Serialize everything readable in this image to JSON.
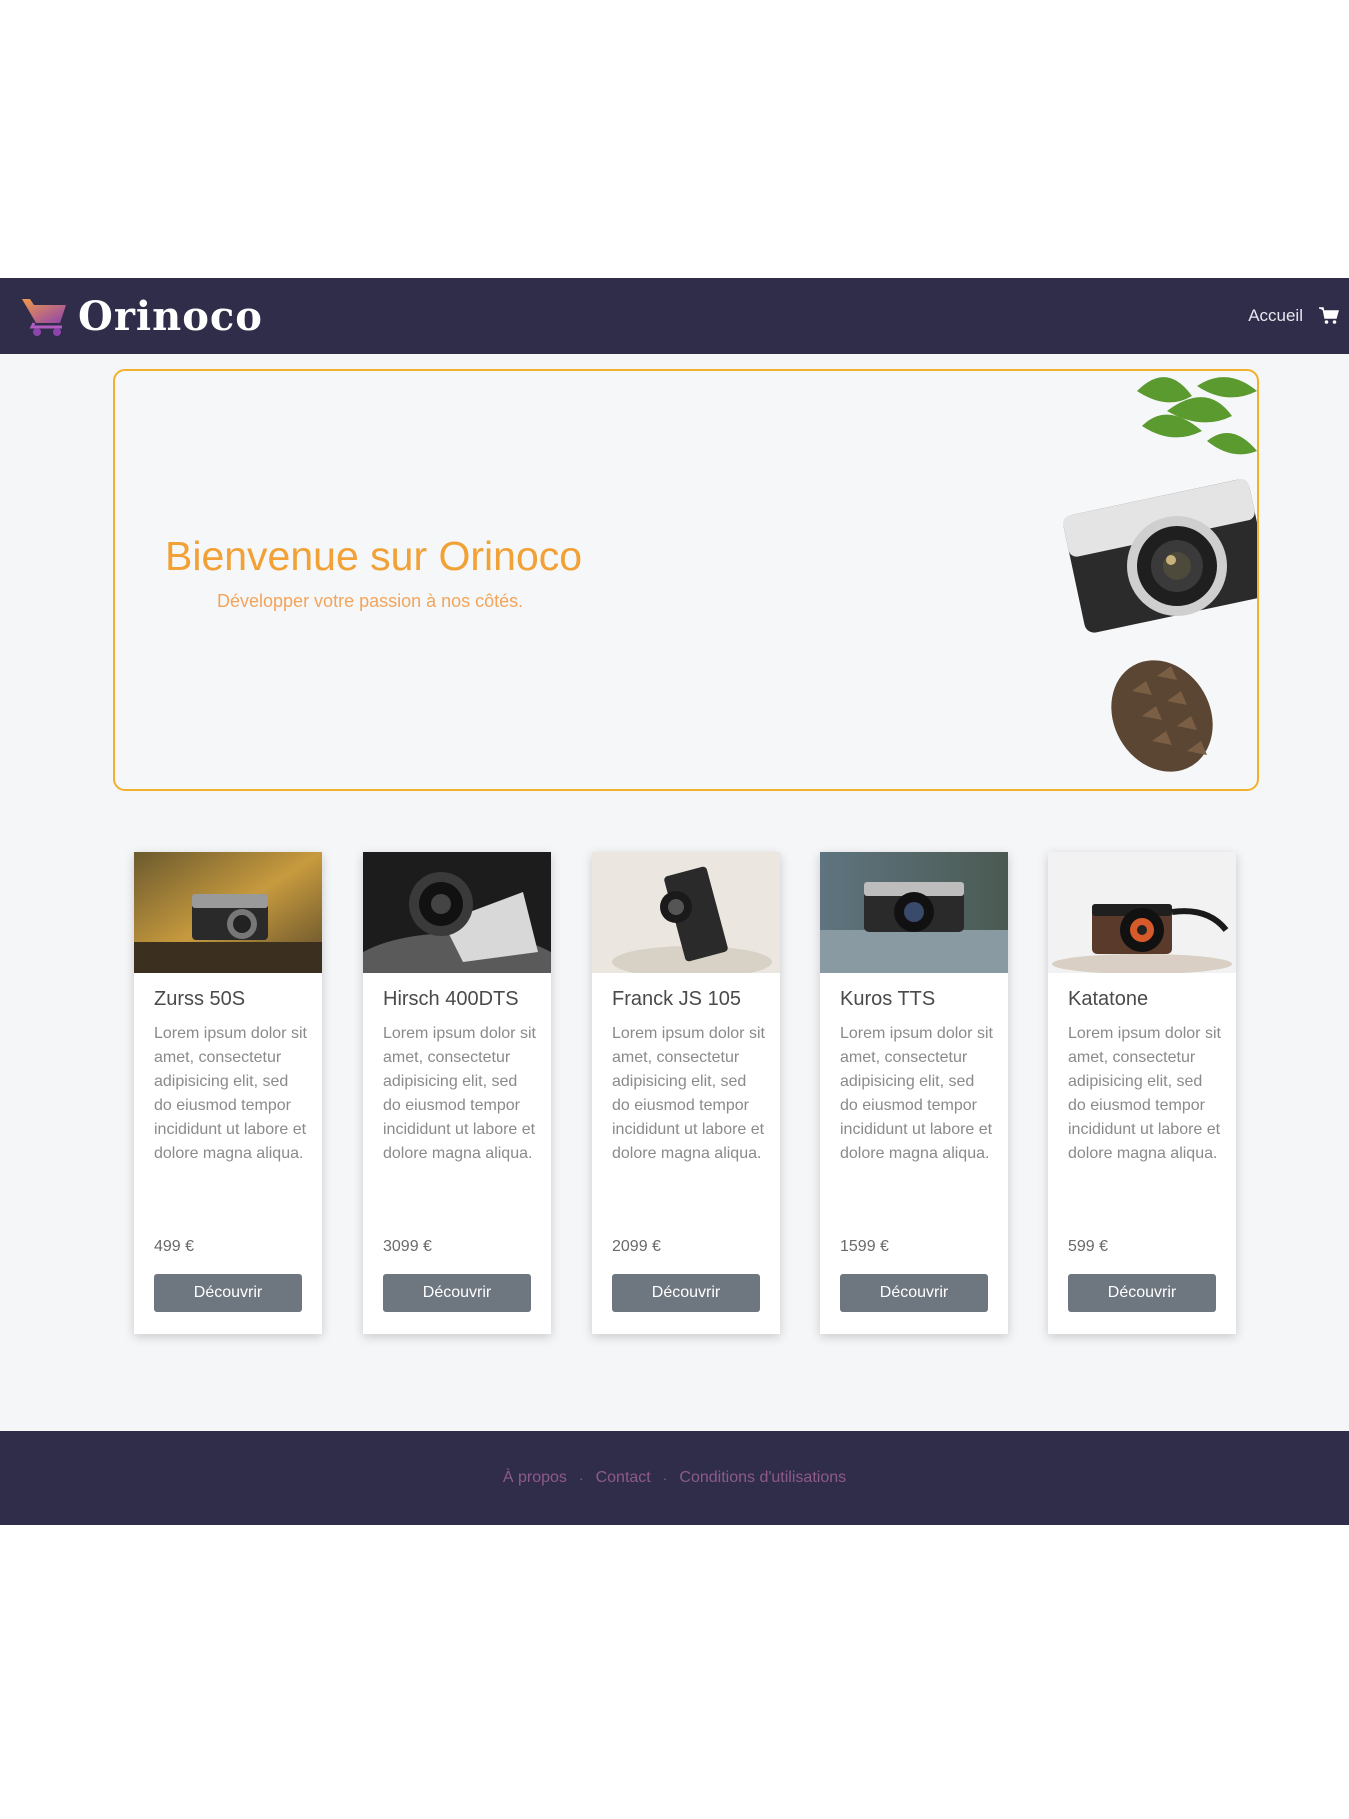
{
  "header": {
    "brand_name": "Orinoco",
    "nav_home": "Accueil",
    "logo_icon": "cart-logo-icon",
    "cart_icon": "cart-icon"
  },
  "hero": {
    "title": "Bienvenue sur Orinoco",
    "subtitle": "Développer votre passion à nos côtés."
  },
  "products": [
    {
      "name": "Zurss 50S",
      "description": "Lorem ipsum dolor sit amet, consectetur adipisicing elit, sed do eiusmod tempor incididunt ut labore et dolore magna aliqua.",
      "price": "499 €",
      "button": "Découvrir"
    },
    {
      "name": "Hirsch 400DTS",
      "description": "Lorem ipsum dolor sit amet, consectetur adipisicing elit, sed do eiusmod tempor incididunt ut labore et dolore magna aliqua.",
      "price": "3099 €",
      "button": "Découvrir"
    },
    {
      "name": "Franck JS 105",
      "description": "Lorem ipsum dolor sit amet, consectetur adipisicing elit, sed do eiusmod tempor incididunt ut labore et dolore magna aliqua.",
      "price": "2099 €",
      "button": "Découvrir"
    },
    {
      "name": "Kuros TTS",
      "description": "Lorem ipsum dolor sit amet, consectetur adipisicing elit, sed do eiusmod tempor incididunt ut labore et dolore magna aliqua.",
      "price": "1599 €",
      "button": "Découvrir"
    },
    {
      "name": "Katatone",
      "description": "Lorem ipsum dolor sit amet, consectetur adipisicing elit, sed do eiusmod tempor incididunt ut labore et dolore magna aliqua.",
      "price": "599 €",
      "button": "Découvrir"
    }
  ],
  "footer": {
    "links": [
      "À propos",
      "Contact",
      "Conditions d'utilisations"
    ]
  },
  "colors": {
    "navbar": "#2f2d4a",
    "accent": "#f1b12d",
    "button": "#6e7680",
    "footer_link": "#8e5a8a"
  }
}
